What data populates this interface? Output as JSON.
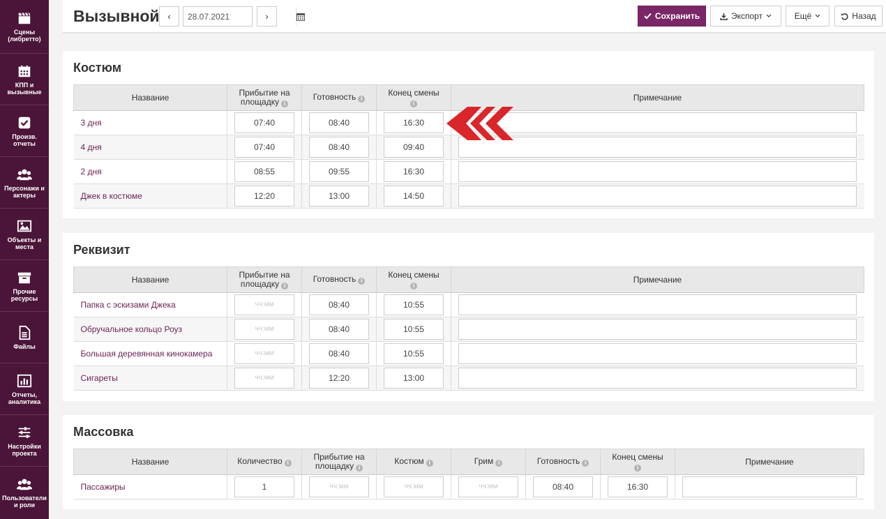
{
  "sidebar": {
    "items": [
      {
        "label": "Сцены (либретто)",
        "icon": "clapperboard-icon"
      },
      {
        "label": "КПП и вызывные",
        "icon": "calendar-icon"
      },
      {
        "label": "Произв. отчеты",
        "icon": "checkbox-icon"
      },
      {
        "label": "Персонажи и актеры",
        "icon": "users-icon"
      },
      {
        "label": "Объекты и места",
        "icon": "image-icon"
      },
      {
        "label": "Прочие ресурсы",
        "icon": "archive-icon"
      },
      {
        "label": "Файлы",
        "icon": "file-icon"
      },
      {
        "label": "Отчеты, аналитика",
        "icon": "bar-chart-icon"
      },
      {
        "label": "Настройки проекта",
        "icon": "sliders-icon"
      },
      {
        "label": "Пользователи и роли",
        "icon": "users-icon"
      }
    ]
  },
  "header": {
    "title": "Вызывной",
    "prev": "‹",
    "next": "›",
    "date": "28.07.2021",
    "save": "Сохранить",
    "export": "Экспорт",
    "more": "Ещё",
    "back": "Назад"
  },
  "placeholder_time": "чч:мм",
  "costume": {
    "title": "Костюм",
    "columns": {
      "name": "Название",
      "arrival": "Прибытие на площадку",
      "ready": "Готовность",
      "end": "Конец смены",
      "note": "Примечание"
    },
    "rows": [
      {
        "name": "3 дня",
        "arrival": "07:40",
        "ready": "08:40",
        "end": "16:30"
      },
      {
        "name": "4 дня",
        "arrival": "07:40",
        "ready": "08:40",
        "end": "09:40"
      },
      {
        "name": "2 дня",
        "arrival": "08:55",
        "ready": "09:55",
        "end": "16:30"
      },
      {
        "name": "Джек в костюме",
        "arrival": "12:20",
        "ready": "13:00",
        "end": "14:50"
      }
    ]
  },
  "props": {
    "title": "Реквизит",
    "columns": {
      "name": "Название",
      "arrival": "Прибытие на площадку",
      "ready": "Готовность",
      "end": "Конец смены",
      "note": "Примечание"
    },
    "rows": [
      {
        "name": "Папка с эскизами Джека",
        "arrival": "",
        "ready": "08:40",
        "end": "10:55"
      },
      {
        "name": "Обручальное кольцо Роуз",
        "arrival": "",
        "ready": "08:40",
        "end": "10:55"
      },
      {
        "name": "Большая деревянная кинокамера",
        "arrival": "",
        "ready": "08:40",
        "end": "10:55"
      },
      {
        "name": "Сигареты",
        "arrival": "",
        "ready": "12:20",
        "end": "13:00"
      }
    ]
  },
  "extras": {
    "title": "Массовка",
    "columns": {
      "name": "Название",
      "qty": "Количество",
      "arrival": "Прибытие на площадку",
      "costume": "Костюм",
      "makeup": "Грим",
      "ready": "Готовность",
      "end": "Конец смены",
      "note": "Примечание"
    },
    "rows": [
      {
        "name": "Пассажиры",
        "qty": "1",
        "arrival": "",
        "costume": "",
        "makeup": "",
        "ready": "08:40",
        "end": "16:30"
      }
    ]
  },
  "colors": {
    "sidebar": "#4a1538",
    "accent": "#7a2767",
    "arrow": "#d9262b",
    "link": "#6d2357"
  }
}
